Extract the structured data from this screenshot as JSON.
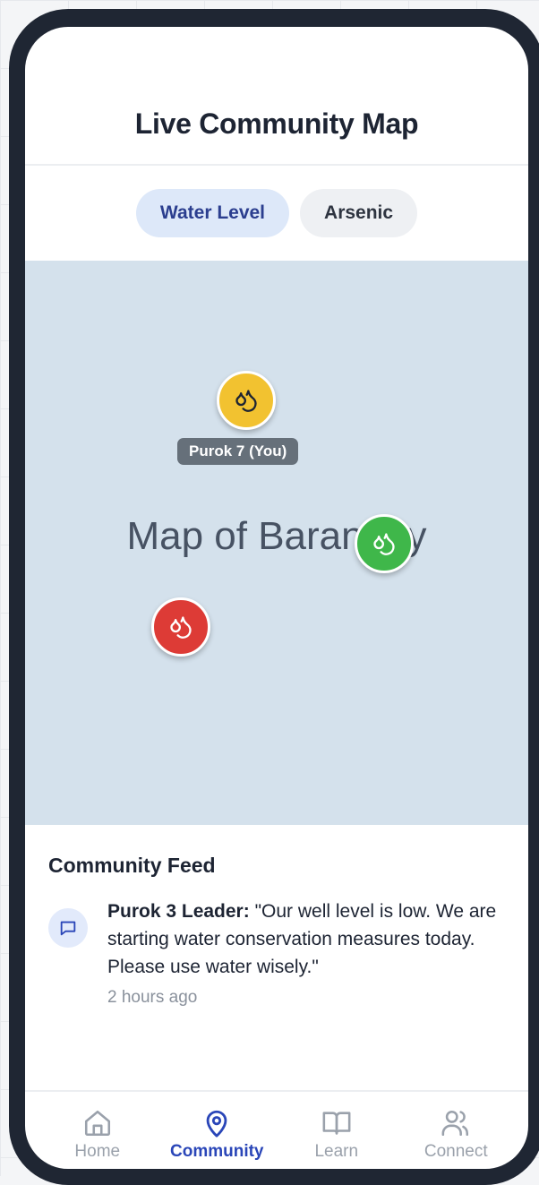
{
  "header": {
    "title": "Live Community Map"
  },
  "tabs": [
    {
      "label": "Water Level",
      "active": true
    },
    {
      "label": "Arsenic",
      "active": false
    }
  ],
  "map": {
    "placeholder": "Map of Barangay",
    "markers": [
      {
        "color": "#f2c230",
        "status": "warning",
        "label": "Purok 7 (You)"
      },
      {
        "color": "#3fb74a",
        "status": "good"
      },
      {
        "color": "#dd3b36",
        "status": "critical"
      }
    ]
  },
  "feed": {
    "title": "Community Feed",
    "items": [
      {
        "author": "Purok 3 Leader:",
        "message": " \"Our well level is low. We are starting water conservation measures today. Please use water wisely.\"",
        "time": "2 hours ago",
        "icon": "message-icon"
      }
    ]
  },
  "nav": [
    {
      "label": "Home",
      "icon": "home-icon",
      "active": false
    },
    {
      "label": "Community",
      "icon": "map-pin-icon",
      "active": true
    },
    {
      "label": "Learn",
      "icon": "book-icon",
      "active": false
    },
    {
      "label": "Connect",
      "icon": "users-icon",
      "active": false
    }
  ],
  "colors": {
    "accent": "#2a46b8",
    "map_bg": "#d4e1ec",
    "frame": "#1f2633"
  }
}
